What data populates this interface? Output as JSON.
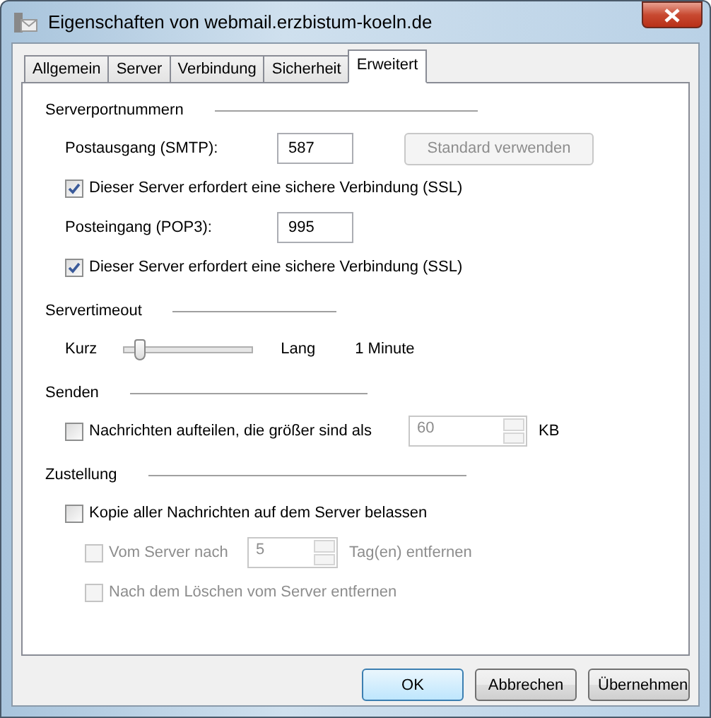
{
  "window": {
    "title": "Eigenschaften von webmail.erzbistum-koeln.de"
  },
  "tabs": [
    {
      "label": "Allgemein",
      "selected": false
    },
    {
      "label": "Server",
      "selected": false
    },
    {
      "label": "Verbindung",
      "selected": false
    },
    {
      "label": "Sicherheit",
      "selected": false
    },
    {
      "label": "Erweitert",
      "selected": true
    }
  ],
  "sections": [
    {
      "title": "Serverportnummern",
      "rows": [
        {
          "kind": "port",
          "label": "Postausgang (SMTP):",
          "value": "587",
          "button": {
            "label": "Standard verwenden",
            "disabled": true
          }
        },
        {
          "kind": "checkbox",
          "label": "Dieser Server erfordert eine sichere Verbindung (SSL)",
          "checked": true,
          "disabled": false
        },
        {
          "kind": "port",
          "label": "Posteingang (POP3):",
          "value": "995"
        },
        {
          "kind": "checkbox",
          "label": "Dieser Server erfordert eine sichere Verbindung (SSL)",
          "checked": true,
          "disabled": false
        }
      ]
    },
    {
      "title": "Servertimeout",
      "rows": [
        {
          "kind": "slider",
          "min_label": "Kurz",
          "max_label": "Lang",
          "level": 0.13,
          "reading": "1 Minute"
        }
      ]
    },
    {
      "title": "Senden",
      "rows": [
        {
          "kind": "spin",
          "label": "Nachrichten aufteilen, die größer sind als",
          "checked": false,
          "disabled": false,
          "value": "60",
          "value_disabled": true,
          "unit": "KB"
        }
      ]
    },
    {
      "title": "Zustellung",
      "rows": [
        {
          "kind": "checkbox",
          "label": "Kopie aller Nachrichten auf dem Server belassen",
          "checked": false,
          "disabled": false,
          "children": [
            {
              "kind": "spin",
              "label": "Vom Server nach",
              "checked": false,
              "disabled": true,
              "value": "5",
              "value_disabled": true,
              "unit": "Tag(en) entfernen"
            },
            {
              "kind": "checkbox",
              "label": "Nach dem Löschen vom Server entfernen",
              "checked": false,
              "disabled": true
            }
          ]
        }
      ]
    }
  ],
  "buttons": [
    {
      "label": "OK",
      "default": true
    },
    {
      "label": "Abbrechen",
      "default": false
    },
    {
      "label": "Übernehmen",
      "default": false
    }
  ]
}
